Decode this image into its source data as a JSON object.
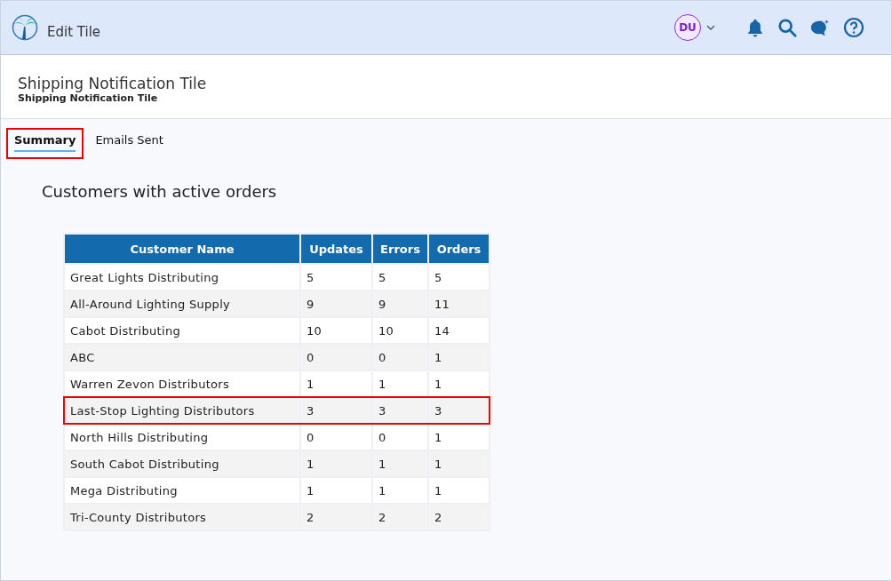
{
  "header": {
    "title": "Edit Tile",
    "avatar": "DU"
  },
  "page": {
    "title": "Shipping Notification Tile",
    "subtitle": "Shipping Notification Tile"
  },
  "tabs": [
    {
      "label": "Summary",
      "selected": true,
      "highlighted": true
    },
    {
      "label": "Emails Sent",
      "selected": false,
      "highlighted": false
    }
  ],
  "section_title": "Customers with active orders",
  "table": {
    "columns": [
      "Customer Name",
      "Updates",
      "Errors",
      "Orders"
    ],
    "rows": [
      {
        "cells": [
          "Great Lights Distributing",
          "5",
          "5",
          "5"
        ],
        "highlighted": false
      },
      {
        "cells": [
          "All-Around Lighting Supply",
          "9",
          "9",
          "11"
        ],
        "highlighted": false
      },
      {
        "cells": [
          "Cabot Distributing",
          "10",
          "10",
          "14"
        ],
        "highlighted": false
      },
      {
        "cells": [
          "ABC",
          "0",
          "0",
          "1"
        ],
        "highlighted": false
      },
      {
        "cells": [
          "Warren Zevon Distributors",
          "1",
          "1",
          "1"
        ],
        "highlighted": false
      },
      {
        "cells": [
          "Last-Stop Lighting Distributors",
          "3",
          "3",
          "3"
        ],
        "highlighted": true
      },
      {
        "cells": [
          "North Hills Distributing",
          "0",
          "0",
          "1"
        ],
        "highlighted": false
      },
      {
        "cells": [
          "South Cabot Distributing",
          "1",
          "1",
          "1"
        ],
        "highlighted": false
      },
      {
        "cells": [
          "Mega Distributing",
          "1",
          "1",
          "1"
        ],
        "highlighted": false
      },
      {
        "cells": [
          "Tri-County Distributors",
          "2",
          "2",
          "2"
        ],
        "highlighted": false
      }
    ]
  }
}
